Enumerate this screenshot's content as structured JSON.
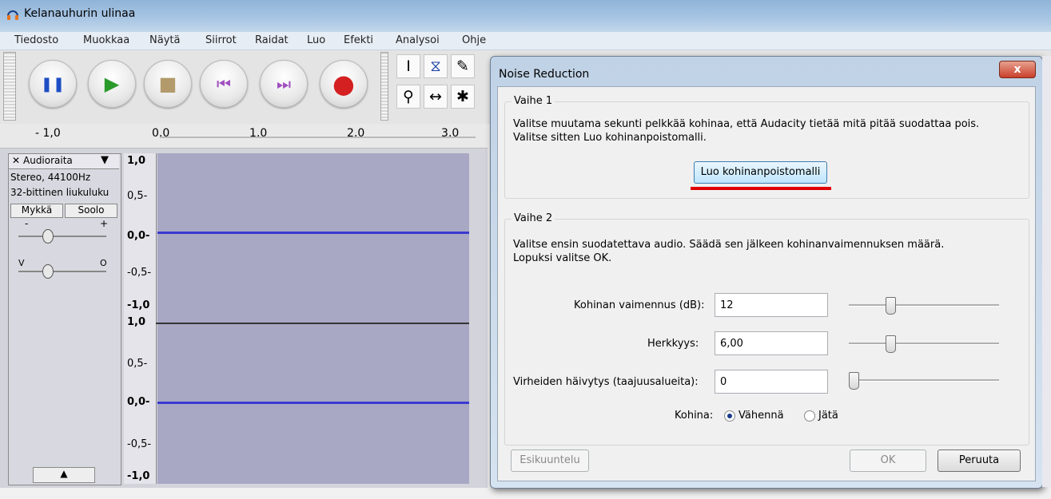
{
  "window": {
    "title": "Kelanauhurin ulinaa"
  },
  "menu": [
    "Tiedosto",
    "Muokkaa",
    "Näytä",
    "Siirrot",
    "Raidat",
    "Luo",
    "Efekti",
    "Analysoi",
    "Ohje"
  ],
  "transport": {
    "pause": "❚❚",
    "play": "▶",
    "stop": "■",
    "skip_start": "⏮",
    "skip_end": "⏭",
    "record": "●"
  },
  "tools": {
    "select": "I",
    "envelope": "⧖",
    "draw": "✎",
    "zoom": "⚲",
    "timeshift": "↔",
    "multi": "✱"
  },
  "ruler": {
    "labels": [
      "- 1,0",
      "0,0",
      "1,0",
      "2,0",
      "3,0"
    ]
  },
  "track": {
    "name": "Audioraita",
    "close": "✕",
    "menu_arrow": "▼",
    "info_rate": "Stereo, 44100Hz",
    "info_format": "32-bittinen liukuluku",
    "mute": "Mykkä",
    "solo": "Soolo",
    "gain_minus": "-",
    "gain_plus": "+",
    "pan_left": "V",
    "pan_right": "O",
    "collapse": "▲",
    "scale_top": [
      "1,0",
      "0,5-",
      "0,0-",
      "-0,5-",
      "-1,0"
    ],
    "scale_bottom": [
      "1,0",
      "0,5-",
      "0,0-",
      "-0,5-",
      "-1,0"
    ]
  },
  "dialog": {
    "title": "Noise Reduction",
    "close": "x",
    "step1": {
      "label": "Vaihe 1",
      "line1": "Valitse muutama sekunti pelkkää kohinaa, että Audacity tietää mitä pitää suodattaa pois.",
      "line2": "Valitse sitten Luo kohinanpoistomalli.",
      "button": "Luo kohinanpoistomalli"
    },
    "step2": {
      "label": "Vaihe 2",
      "line1": "Valitse ensin suodatettava audio. Säädä sen jälkeen kohinanvaimennuksen määrä.",
      "line2": "Lopuksi valitse OK.",
      "fields": [
        {
          "label": "Kohinan vaimennus (dB):",
          "value": "12",
          "level": 0.3
        },
        {
          "label": "Herkkyys:",
          "value": "6,00",
          "level": 0.3
        },
        {
          "label": "Virheiden häivytys (taajuusalueita):",
          "value": "0",
          "level": 0.0
        }
      ],
      "noise_label": "Kohina:",
      "options": [
        {
          "label": "Vähennä",
          "selected": true
        },
        {
          "label": "Jätä",
          "selected": false
        }
      ]
    },
    "buttons": {
      "preview": "Esikuuntelu",
      "ok": "OK",
      "cancel": "Peruuta"
    }
  },
  "colors": {
    "highlight_underline": "#e00000",
    "waveform": "#3a3ad0"
  }
}
